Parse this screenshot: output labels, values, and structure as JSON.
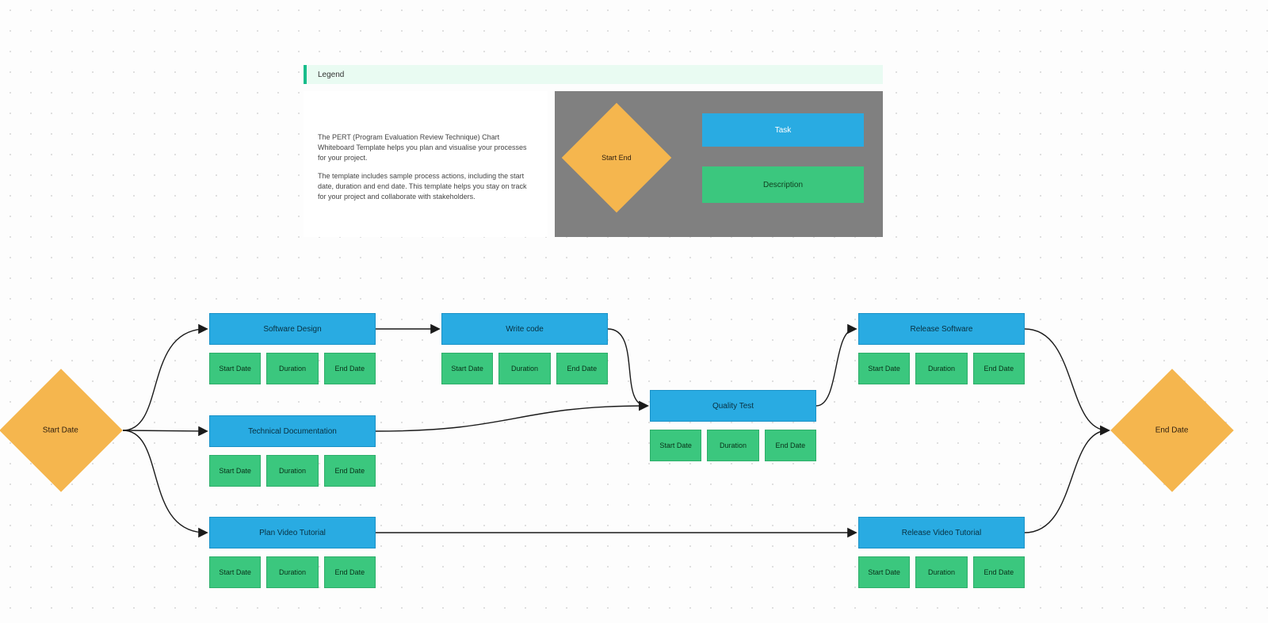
{
  "legend": {
    "title": "Legend",
    "description_p1": "The PERT (Program Evaluation Review Technique) Chart Whiteboard Template helps you plan and visualise your processes for your project.",
    "description_p2": "The template includes sample process actions, including the start date, duration and end date. This template helps you stay on track for your project and collaborate with stakeholders.",
    "start_end_label": "Start End",
    "task_label": "Task",
    "description_label": "Description"
  },
  "start_diamond": "Start Date",
  "end_diamond": "End Date",
  "desc_labels": {
    "start": "Start Date",
    "duration": "Duration",
    "end": "End Date"
  },
  "nodes": {
    "software_design": "Software Design",
    "write_code": "Write code",
    "technical_documentation": "Technical Documentation",
    "plan_video_tutorial": "Plan Video Tutorial",
    "quality_test": "Quality Test",
    "release_software": "Release Software",
    "release_video_tutorial": "Release Video Tutorial"
  }
}
